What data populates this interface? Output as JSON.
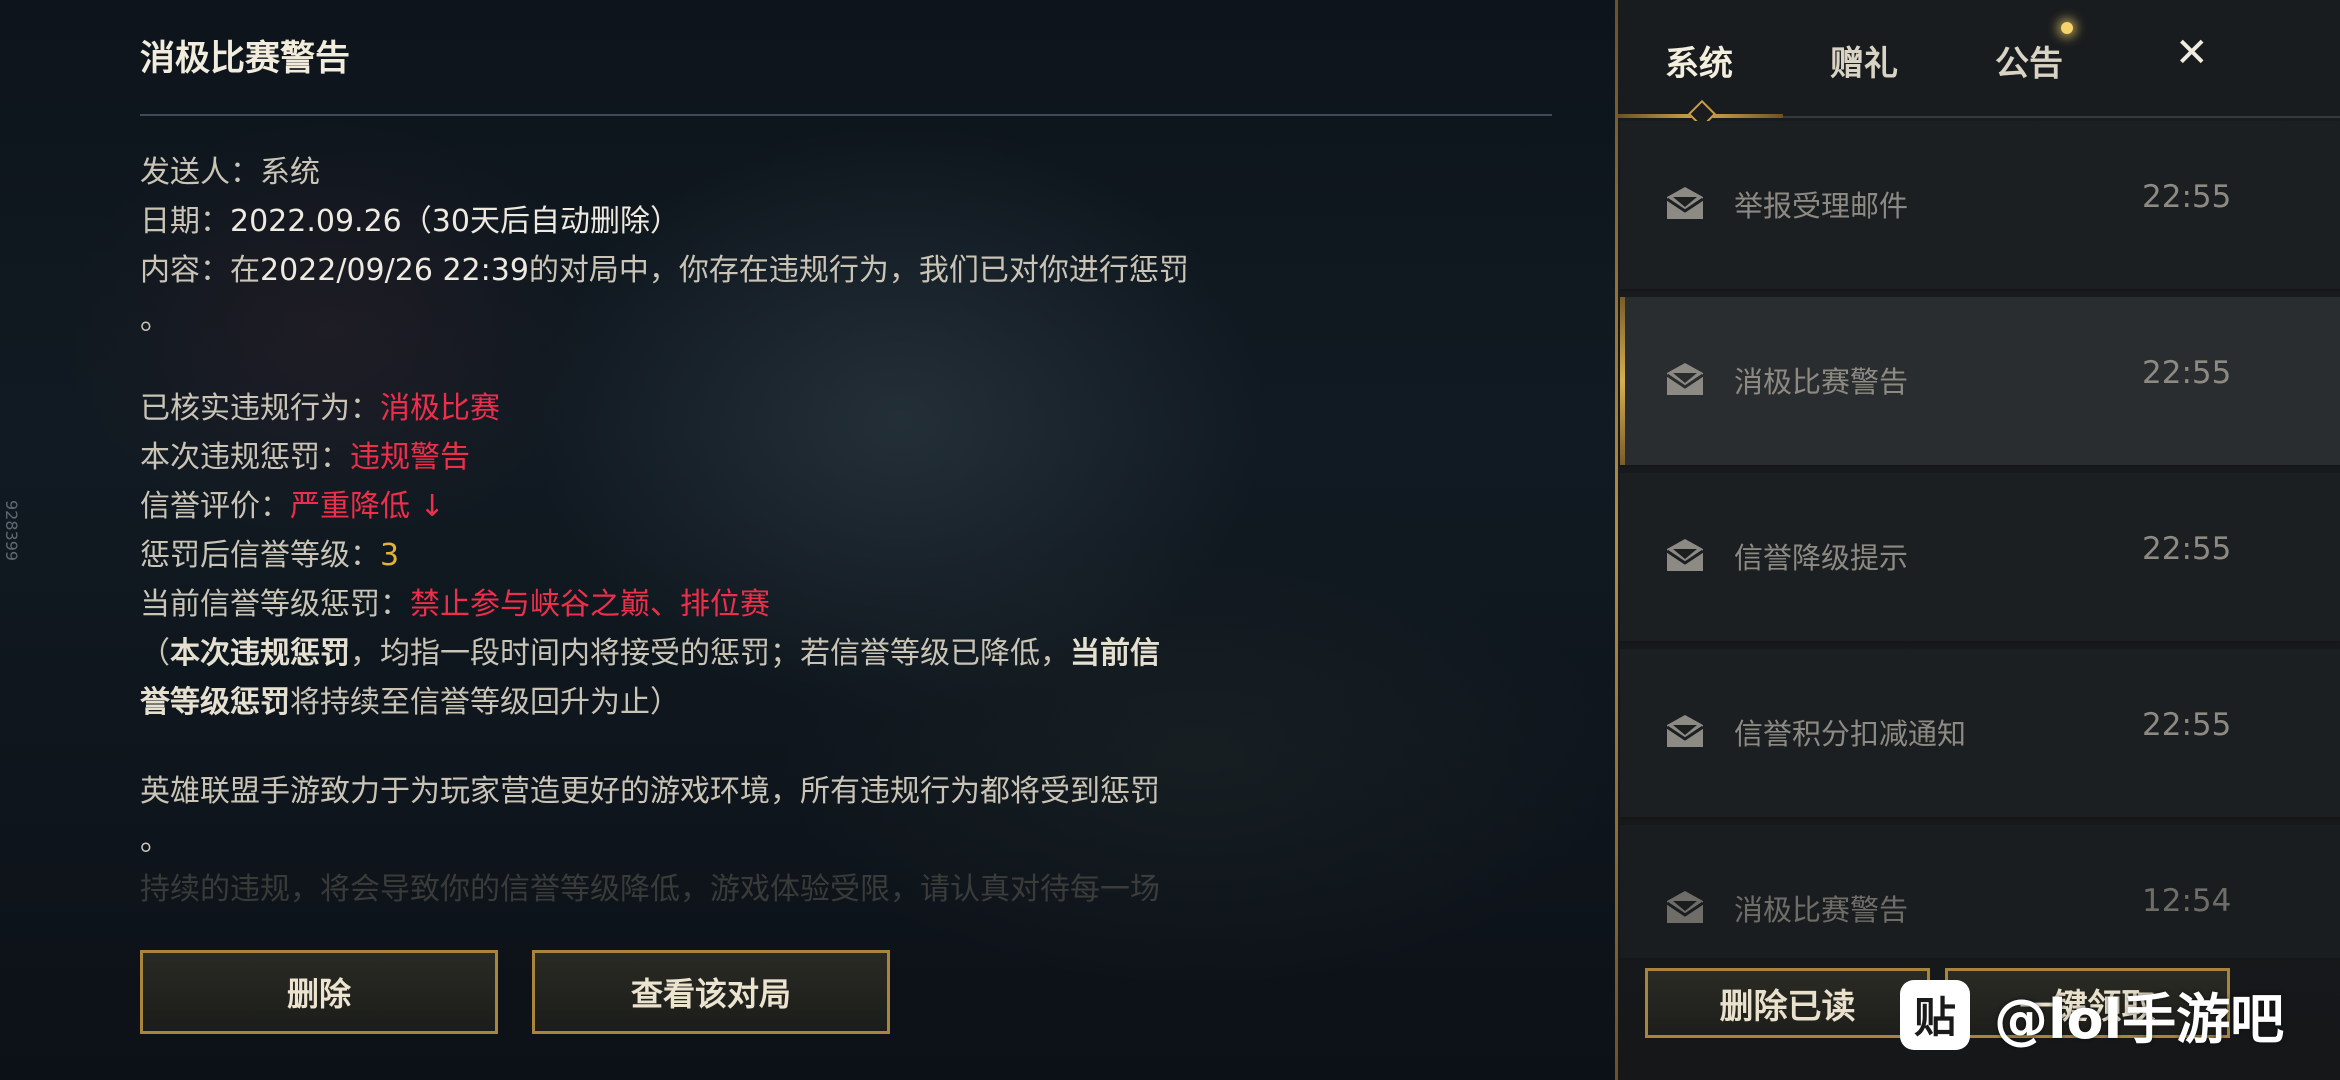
{
  "mail": {
    "title": "消极比赛警告",
    "sender_label": "发送人：",
    "sender": "系统",
    "date_label": "日期：",
    "date": "2022.09.26（30天后自动删除）",
    "content_label": "内容：",
    "content_pre": "在",
    "content_datetime": "2022/09/26 22:39",
    "content_rest": "的对局中，你存在违规行为，我们已对你进行惩罚",
    "content_end": "。",
    "verified_label": "已核实违规行为：",
    "verified_value": "消极比赛",
    "penalty_label": "本次违规惩罚：",
    "penalty_value": "违规警告",
    "credit_label": "信誉评价：",
    "credit_value": "严重降低 ↓",
    "level_label": "惩罚后信誉等级：",
    "level_value": "3",
    "current_label": "当前信誉等级惩罚：",
    "current_value": "禁止参与峡谷之巅、排位赛",
    "note_open": "（",
    "note_bold1": "本次违规惩罚",
    "note_mid": "，均指一段时间内将接受的惩罚；若信誉等级已降低，",
    "note_bold2a": "当前信",
    "note_bold2b": "誉等级惩罚",
    "note_end": "将持续至信誉等级回升为止）",
    "closing": "英雄联盟手游致力于为玩家营造更好的游戏环境，所有违规行为都将受到惩罚",
    "closing_end": "。",
    "faded_line": "持续的违规，将会导致你的信誉等级降低，游戏体验受限，请认真对待每一场"
  },
  "buttons": {
    "delete": "删除",
    "view_match": "查看该对局"
  },
  "side_code": "928399",
  "panel": {
    "tabs": [
      "系统",
      "赠礼",
      "公告"
    ],
    "close": "✕",
    "items": [
      {
        "name": "举报受理邮件",
        "time": "22:55"
      },
      {
        "name": "消极比赛警告",
        "time": "22:55"
      },
      {
        "name": "信誉降级提示",
        "time": "22:55"
      },
      {
        "name": "信誉积分扣减通知",
        "time": "22:55"
      },
      {
        "name": "消极比赛警告",
        "time": "12:54"
      }
    ],
    "delete_read": "删除已读",
    "claim_all": "一键领取"
  },
  "watermark": {
    "logo": "贴",
    "text": "@lol手游吧"
  },
  "colors": {
    "accent_gold": "#a8843d",
    "highlight_red": "#ee2e4b",
    "level_gold": "#e3b236"
  }
}
